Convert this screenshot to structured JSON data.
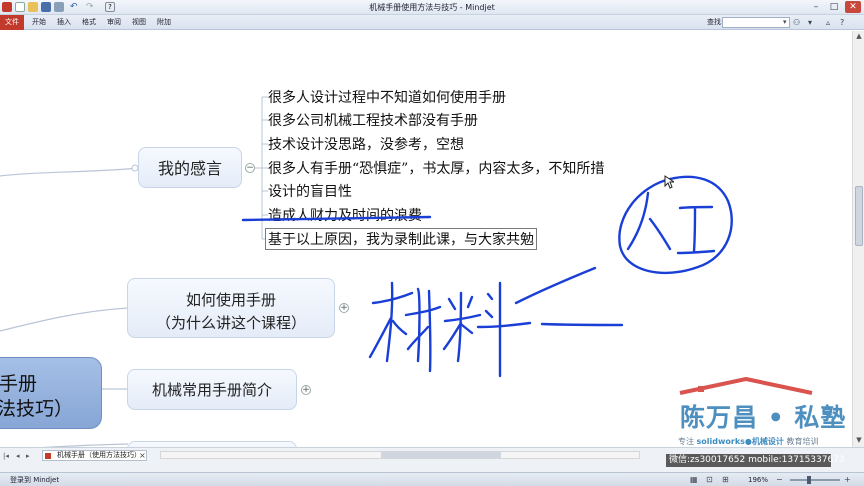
{
  "window": {
    "title": "机械手册使用方法与技巧 - Mindjet"
  },
  "ribbon": {
    "file_tab": "文件",
    "tabs": [
      "开始",
      "插入",
      "格式",
      "审阅",
      "视图",
      "附加"
    ],
    "find_label": "查找:",
    "help_icon": "help-icon"
  },
  "mindmap": {
    "central_topic_lines": [
      "手册",
      "法技巧）"
    ],
    "topics": [
      {
        "label": "我的感言",
        "toggle": "−"
      },
      {
        "label_lines": [
          "如何使用手册",
          "（为什么讲这个课程）"
        ],
        "toggle": "+"
      },
      {
        "label": "机械常用手册简介",
        "toggle": "+"
      }
    ],
    "subtopics": [
      "很多人设计过程中不知道如何使用手册",
      "很多公司机械工程技术部没有手册",
      "技术设计没思路，没参考，空想",
      "很多人有手册“恐惧症”，书太厚，内容太多，不知所措",
      "设计的盲目性",
      "造成人财力及时间的浪费",
      "基于以上原因，我为录制此课，与大家共勉"
    ],
    "handwriting_color": "#1a3fd6"
  },
  "watermark": {
    "name": "陈万昌 • 私塾",
    "tagline_prefix": "专注",
    "tagline_highlight": "solidworks●机械设计",
    "tagline_suffix": "教育培训",
    "contact": "微信:zs30017652   mobile:13715337673"
  },
  "document_tabs": {
    "active": "机械手册（使用方法技巧）",
    "close": "×"
  },
  "status": {
    "text": "登录到 Mindjet",
    "zoom": "196%"
  },
  "colors": {
    "accent": "#c23a2c",
    "node_fill": "#e8eef8",
    "central_fill": "#8fabd9",
    "brand": "#4d8fbf"
  }
}
